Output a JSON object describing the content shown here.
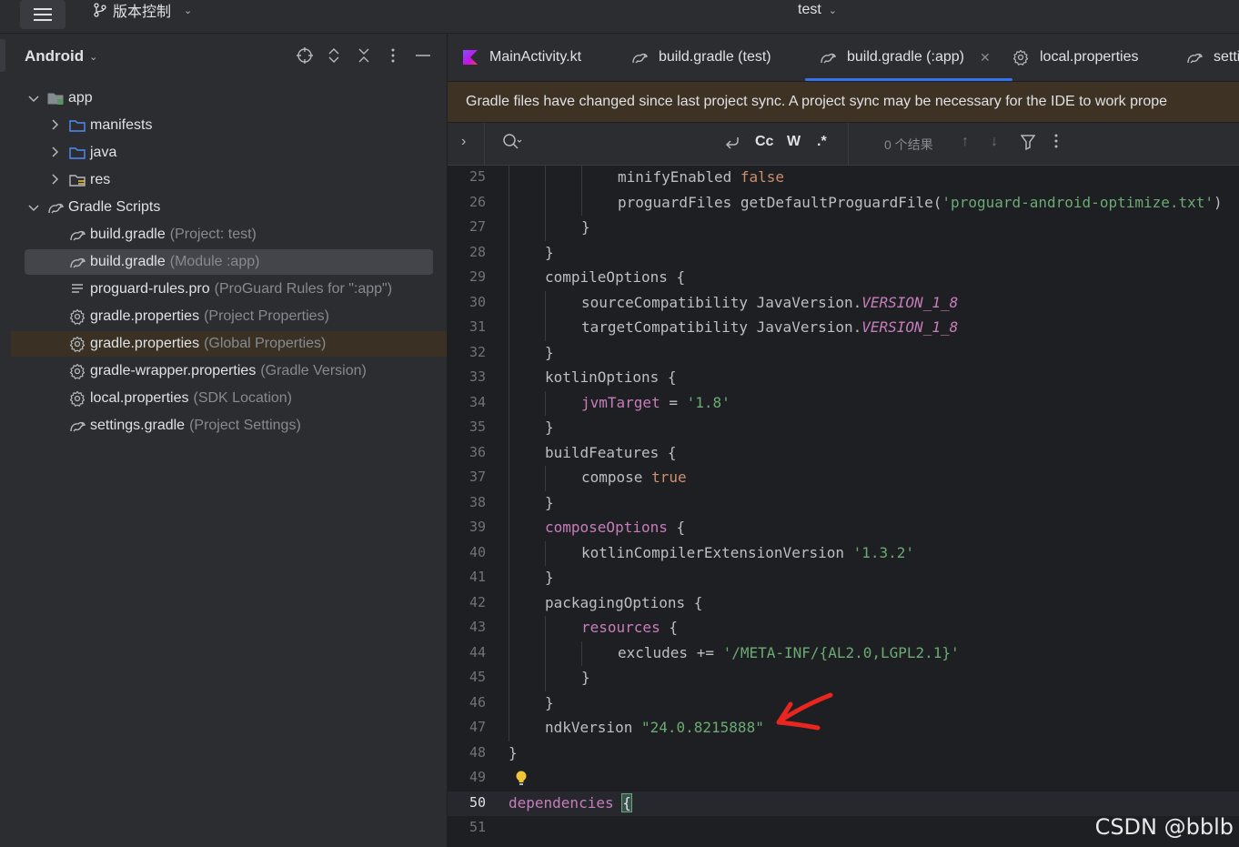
{
  "titlebar": {
    "vcs_label": "版本控制",
    "project_name": "test"
  },
  "project_panel": {
    "title": "Android",
    "tree": [
      {
        "name": "app",
        "sub": "",
        "icon": "module-folder-icon",
        "chevron": "down",
        "indent": 0
      },
      {
        "name": "manifests",
        "sub": "",
        "icon": "folder-icon",
        "chevron": "right",
        "indent": 1
      },
      {
        "name": "java",
        "sub": "",
        "icon": "folder-icon",
        "chevron": "right",
        "indent": 1
      },
      {
        "name": "res",
        "sub": "",
        "icon": "res-folder-icon",
        "chevron": "right",
        "indent": 1
      },
      {
        "name": "Gradle Scripts",
        "sub": "",
        "icon": "gradle-icon",
        "chevron": "down",
        "indent": 0
      },
      {
        "name": "build.gradle",
        "sub": "(Project: test)",
        "icon": "gradle-icon",
        "chevron": "",
        "indent": 1
      },
      {
        "name": "build.gradle",
        "sub": "(Module :app)",
        "icon": "gradle-icon",
        "chevron": "",
        "indent": 1,
        "selected": true
      },
      {
        "name": "proguard-rules.pro",
        "sub": "(ProGuard Rules for \":app\")",
        "icon": "text-file-icon",
        "chevron": "",
        "indent": 1
      },
      {
        "name": "gradle.properties",
        "sub": "(Project Properties)",
        "icon": "gear-icon",
        "chevron": "",
        "indent": 1
      },
      {
        "name": "gradle.properties",
        "sub": "(Global Properties)",
        "icon": "gear-icon",
        "chevron": "",
        "indent": 1,
        "highlight": true
      },
      {
        "name": "gradle-wrapper.properties",
        "sub": "(Gradle Version)",
        "icon": "gear-icon",
        "chevron": "",
        "indent": 1
      },
      {
        "name": "local.properties",
        "sub": "(SDK Location)",
        "icon": "gear-icon",
        "chevron": "",
        "indent": 1
      },
      {
        "name": "settings.gradle",
        "sub": "(Project Settings)",
        "icon": "gradle-icon",
        "chevron": "",
        "indent": 1
      }
    ]
  },
  "editor": {
    "tabs": [
      {
        "label": "MainActivity.kt",
        "icon": "kotlin-icon"
      },
      {
        "label": "build.gradle (test)",
        "icon": "gradle-icon"
      },
      {
        "label": "build.gradle (:app)",
        "icon": "gradle-icon",
        "active": true
      },
      {
        "label": "local.properties",
        "icon": "gear-icon"
      },
      {
        "label": "setti",
        "icon": "gradle-icon"
      }
    ],
    "banner": "Gradle files have changed since last project sync. A project sync may be necessary for the IDE to work prope",
    "find": {
      "case_label": "Cc",
      "word_label": "W",
      "regex_label": ".*",
      "results": "0 个结果"
    },
    "lines": [
      {
        "n": "25",
        "indent": 3,
        "parts": [
          [
            "plain",
            "minifyEnabled "
          ],
          [
            "kw",
            "false"
          ]
        ]
      },
      {
        "n": "26",
        "indent": 3,
        "parts": [
          [
            "plain",
            "proguardFiles getDefaultProguardFile("
          ],
          [
            "str",
            "'proguard-android-optimize.txt'"
          ],
          [
            "plain",
            ")"
          ]
        ]
      },
      {
        "n": "27",
        "indent": 2,
        "parts": [
          [
            "plain",
            "}"
          ]
        ]
      },
      {
        "n": "28",
        "indent": 1,
        "parts": [
          [
            "plain",
            "}"
          ]
        ]
      },
      {
        "n": "29",
        "indent": 1,
        "parts": [
          [
            "plain",
            "compileOptions {"
          ]
        ]
      },
      {
        "n": "30",
        "indent": 2,
        "parts": [
          [
            "plain",
            "sourceCompatibility JavaVersion."
          ],
          [
            "ital",
            "VERSION_1_8"
          ]
        ]
      },
      {
        "n": "31",
        "indent": 2,
        "parts": [
          [
            "plain",
            "targetCompatibility JavaVersion."
          ],
          [
            "ital",
            "VERSION_1_8"
          ]
        ]
      },
      {
        "n": "32",
        "indent": 1,
        "parts": [
          [
            "plain",
            "}"
          ]
        ]
      },
      {
        "n": "33",
        "indent": 1,
        "parts": [
          [
            "plain",
            "kotlinOptions {"
          ]
        ]
      },
      {
        "n": "34",
        "indent": 2,
        "parts": [
          [
            "prop",
            "jvmTarget"
          ],
          [
            "plain",
            " = "
          ],
          [
            "str",
            "'1.8'"
          ]
        ]
      },
      {
        "n": "35",
        "indent": 1,
        "parts": [
          [
            "plain",
            "}"
          ]
        ]
      },
      {
        "n": "36",
        "indent": 1,
        "parts": [
          [
            "plain",
            "buildFeatures {"
          ]
        ]
      },
      {
        "n": "37",
        "indent": 2,
        "parts": [
          [
            "plain",
            "compose "
          ],
          [
            "kw",
            "true"
          ]
        ]
      },
      {
        "n": "38",
        "indent": 1,
        "parts": [
          [
            "plain",
            "}"
          ]
        ]
      },
      {
        "n": "39",
        "indent": 1,
        "parts": [
          [
            "prop",
            "composeOptions"
          ],
          [
            "plain",
            " {"
          ]
        ]
      },
      {
        "n": "40",
        "indent": 2,
        "parts": [
          [
            "plain",
            "kotlinCompilerExtensionVersion "
          ],
          [
            "str",
            "'1.3.2'"
          ]
        ]
      },
      {
        "n": "41",
        "indent": 1,
        "parts": [
          [
            "plain",
            "}"
          ]
        ]
      },
      {
        "n": "42",
        "indent": 1,
        "parts": [
          [
            "plain",
            "packagingOptions {"
          ]
        ]
      },
      {
        "n": "43",
        "indent": 2,
        "parts": [
          [
            "prop",
            "resources"
          ],
          [
            "plain",
            " {"
          ]
        ]
      },
      {
        "n": "44",
        "indent": 3,
        "parts": [
          [
            "plain",
            "excludes += "
          ],
          [
            "str",
            "'/META-INF/{AL2.0,LGPL2.1}'"
          ]
        ]
      },
      {
        "n": "45",
        "indent": 2,
        "parts": [
          [
            "plain",
            "}"
          ]
        ]
      },
      {
        "n": "46",
        "indent": 1,
        "parts": [
          [
            "plain",
            "}"
          ]
        ]
      },
      {
        "n": "47",
        "indent": 1,
        "parts": [
          [
            "plain",
            "ndkVersion "
          ],
          [
            "str",
            "\"24.0.8215888\""
          ]
        ]
      },
      {
        "n": "48",
        "indent": 0,
        "parts": [
          [
            "plain",
            "}"
          ]
        ]
      },
      {
        "n": "49",
        "indent": 0,
        "parts": []
      },
      {
        "n": "50",
        "indent": 0,
        "parts": [
          [
            "prop",
            "dependencies"
          ],
          [
            "plain",
            " "
          ],
          [
            "hl",
            "{"
          ]
        ],
        "current": true
      },
      {
        "n": "51",
        "indent": 0,
        "parts": []
      }
    ]
  },
  "watermark": "CSDN @bblb",
  "colors": {
    "accent": "#3574f0",
    "annotation_arrow": "#e8251f",
    "banner_bg": "#3d3223"
  }
}
